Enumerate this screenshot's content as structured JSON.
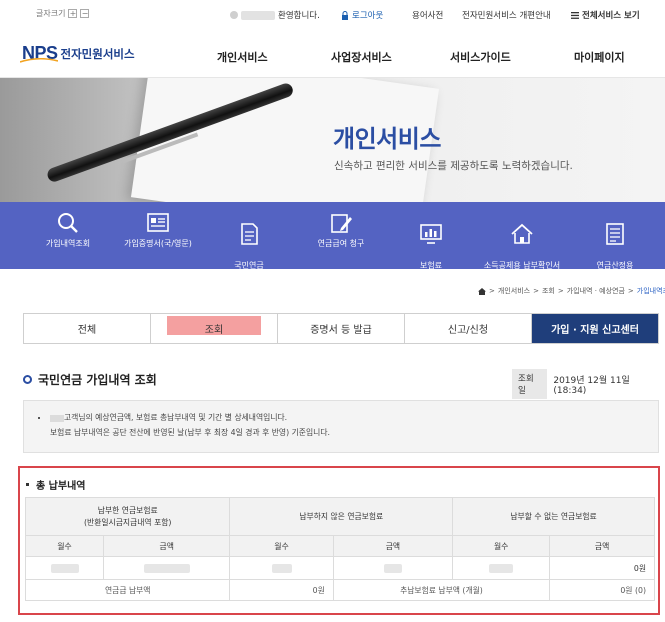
{
  "top": {
    "font_size_label": "글자크기",
    "font_plus": "+",
    "font_minus": "−",
    "welcome": "환영합니다.",
    "logout": "로그아웃",
    "glossary": "용어사전",
    "renewal": "전자민원서비스 개편안내",
    "all_services": "전체서비스 보기"
  },
  "header": {
    "logo_text": "NPS",
    "site_name": "전자민원서비스",
    "nav": [
      "개인서비스",
      "사업장서비스",
      "서비스가이드",
      "마이페이지"
    ]
  },
  "hero": {
    "title": "개인서비스",
    "subtitle": "신속하고 편리한 서비스를 제공하도록 노력하겠습니다."
  },
  "quick_menu": [
    {
      "icon": "magnifier-icon",
      "label": "가입내역조회"
    },
    {
      "icon": "certificate-icon",
      "label": "가입증명서(국/영문)"
    },
    {
      "icon": "document-icon",
      "label": "국민연금\n찾아가세요"
    },
    {
      "icon": "pencil-form-icon",
      "label": "연금급여 청구"
    },
    {
      "icon": "monitor-chart-icon",
      "label": "보험료\n결정내역(개인)"
    },
    {
      "icon": "house-icon",
      "label": "소득공제용 납부확인서\n(개인)조회/증명"
    },
    {
      "icon": "list-document-icon",
      "label": "연금산정용\n가입내역확인서(국/영문)"
    }
  ],
  "breadcrumb": [
    "개인서비스",
    "조회",
    "가입내역 · 예상연금",
    "가입내역조회"
  ],
  "tabs": [
    "전체",
    "조회",
    "증명서 등 발급",
    "신고/신청",
    "가입 · 지원 신고센터"
  ],
  "page": {
    "title": "국민연금 가입내역 조회",
    "inquiry_label": "조회일",
    "inquiry_date": "2019년 12월 11일 (18:34)"
  },
  "notice": {
    "line1": "고객님의 예상연금액, 보험료 총납부내역 및 기간 별 상세내역입니다.",
    "line2": "보험료 납부내역은 공단 전산에 반영된 날(납부 후 최장 4일 경과 후 반영) 기준입니다."
  },
  "payment": {
    "title": "총 납부내역",
    "group1": "납부한 연금보험료\n(반환일시금지급내역 포함)",
    "group2": "납부하지 않은 연금보험료",
    "group3": "납부할 수 없는 연금보험료",
    "col_months": "월수",
    "col_amount": "금액",
    "row_last_value": "0원",
    "summary_left_label": "연금급 납부액",
    "summary_left_value": "0원",
    "summary_right_label": "추납보험료 납부액 (개월)",
    "summary_right_value": "0원 (0)"
  },
  "colors": {
    "brand_blue": "#1a3e8c",
    "quick_band": "#5463c2",
    "tab_dark": "#1f3e7b",
    "highlight_red": "#d9454b",
    "highlight_pink": "#f4a0a0"
  }
}
